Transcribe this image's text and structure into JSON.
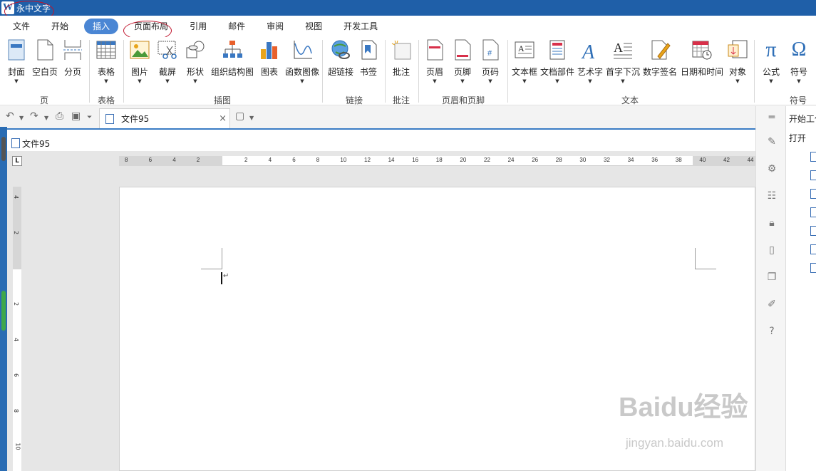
{
  "app": {
    "title": "永中文字",
    "logo": "W"
  },
  "menu": {
    "tabs": [
      {
        "label": "文件"
      },
      {
        "label": "开始"
      },
      {
        "label": "插入",
        "active": true
      },
      {
        "label": "页面布局"
      },
      {
        "label": "引用"
      },
      {
        "label": "邮件"
      },
      {
        "label": "审阅"
      },
      {
        "label": "视图"
      },
      {
        "label": "开发工具"
      }
    ]
  },
  "ribbon": {
    "buttons": {
      "cover": "封面",
      "blank_page": "空白页",
      "page_break": "分页",
      "table": "表格",
      "picture": "图片",
      "screenshot": "截屏",
      "shape": "形状",
      "org_chart": "组织结构图",
      "chart": "图表",
      "function_image": "函数图像",
      "hyperlink": "超链接",
      "bookmark": "书签",
      "comment": "批注",
      "header": "页眉",
      "footer": "页脚",
      "page_number": "页码",
      "textbox": "文本框",
      "doc_parts": "文档部件",
      "wordart": "艺术字",
      "drop_cap": "首字下沉",
      "digital_signature": "数字签名",
      "datetime": "日期和时间",
      "object": "对象",
      "formula": "公式",
      "symbol": "符号"
    },
    "groups": {
      "page": "页",
      "table": "表格",
      "illustrations": "插图",
      "links": "链接",
      "comments": "批注",
      "header_footer": "页眉和页脚",
      "text": "文本",
      "symbols": "符号"
    }
  },
  "document": {
    "tab_name": "文件95",
    "path_name": "文件95"
  },
  "ruler": {
    "h_ticks": [
      "8",
      "6",
      "4",
      "2",
      "2",
      "4",
      "6",
      "8",
      "10",
      "12",
      "14",
      "16",
      "18",
      "20",
      "22",
      "24",
      "26",
      "28",
      "30",
      "32",
      "34",
      "36",
      "38",
      "40",
      "42",
      "44"
    ],
    "v_ticks": [
      "4",
      "2",
      "2",
      "4",
      "6",
      "8",
      "10"
    ],
    "corner": "L"
  },
  "right_panel": {
    "title": "开始工作",
    "open_label": "打开"
  },
  "watermark": {
    "main": "Baidu经验",
    "sub": "jingyan.baidu.com"
  },
  "colors": {
    "titlebar": "#1f5fa8",
    "active_tab": "#4a86d4",
    "annotation": "#c0142c"
  }
}
